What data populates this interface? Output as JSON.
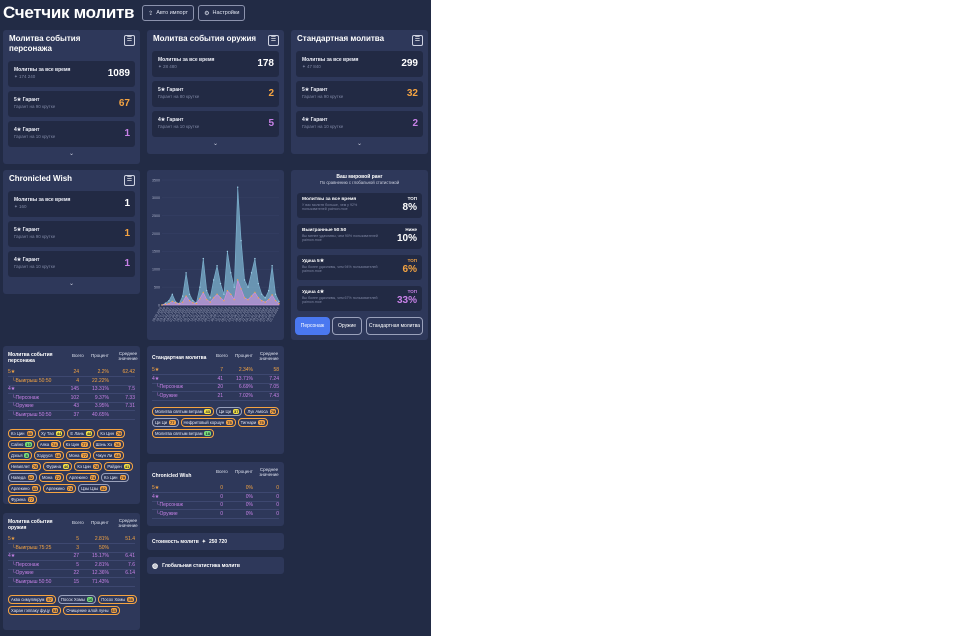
{
  "app": {
    "title": "Счетчик молитв",
    "auto_import": "Авто импорт",
    "settings": "Настройки"
  },
  "panels": {
    "character": {
      "title": "Молитва события персонажа",
      "total_label": "Молитвы за все время",
      "total_sub": "174 240",
      "total": "1089",
      "g5_label": "5★ Гарант",
      "g5_sub": "Гарант на 90 крутке",
      "g5": "67",
      "g4_label": "4★ Гарант",
      "g4_sub": "Гарант на 10 крутке",
      "g4": "1"
    },
    "weapon": {
      "title": "Молитва события оружия",
      "total_label": "Молитвы за все время",
      "total_sub": "28 480",
      "total": "178",
      "g5_label": "5★ Гарант",
      "g5_sub": "Гарант на 80 крутке",
      "g5": "2",
      "g4_label": "4★ Гарант",
      "g4_sub": "Гарант на 10 крутке",
      "g4": "5"
    },
    "standard": {
      "title": "Стандартная молитва",
      "total_label": "Молитвы за все время",
      "total_sub": "47 840",
      "total": "299",
      "g5_label": "5★ Гарант",
      "g5_sub": "Гарант на 90 крутке",
      "g5": "32",
      "g4_label": "4★ Гарант",
      "g4_sub": "Гарант на 10 крутке",
      "g4": "2"
    },
    "chronicled": {
      "title": "Chronicled Wish",
      "total_label": "Молитвы за все время",
      "total_sub": "160",
      "total": "1",
      "g5_label": "5★ Гарант",
      "g5_sub": "Гарант на 90 крутке",
      "g5": "1",
      "g4_label": "4★ Гарант",
      "g4_sub": "Гарант на 10 крутке",
      "g4": "1"
    }
  },
  "chart_data": {
    "type": "area",
    "ylim": [
      0,
      3500
    ],
    "yticks": [
      "0",
      "500",
      "1000",
      "1500",
      "2000",
      "2500",
      "3000",
      "3500"
    ],
    "x": [
      "28.09.2020",
      "10.11.2020",
      "23.12.2020",
      "04.02.2021",
      "19.03.2021",
      "01.05.2021",
      "13.06.2021",
      "26.07.2021",
      "07.09.2021",
      "20.10.2021",
      "02.12.2021",
      "14.01.2022",
      "26.02.2022",
      "10.04.2022",
      "23.05.2022",
      "05.07.2022",
      "17.08.2022",
      "30.09.2022",
      "12.11.2022",
      "25.12.2022",
      "06.02.2023",
      "21.03.2023",
      "03.05.2023",
      "15.06.2023",
      "28.07.2023",
      "09.09.2023",
      "22.10.2023",
      "04.12.2023",
      "16.01.2024",
      "29.02.2024",
      "12.04.2024",
      "25.05.2024",
      "07.07.2024",
      "19.08.2024",
      "01.10.2024"
    ],
    "series": [
      {
        "name": "",
        "values": [
          0,
          50,
          120,
          300,
          80,
          40,
          250,
          900,
          300,
          120,
          60,
          500,
          1300,
          400,
          200,
          700,
          1100,
          600,
          300,
          1500,
          900,
          500,
          3300,
          1800,
          700,
          500,
          900,
          1300,
          600,
          300,
          200,
          400,
          1100,
          300,
          100
        ]
      },
      {
        "name": "",
        "values": [
          0,
          20,
          40,
          100,
          60,
          30,
          80,
          250,
          120,
          60,
          40,
          180,
          350,
          150,
          80,
          200,
          300,
          200,
          120,
          400,
          300,
          150,
          700,
          450,
          200,
          150,
          250,
          350,
          200,
          120,
          80,
          150,
          280,
          120,
          40
        ]
      }
    ]
  },
  "rank": {
    "title": "Ваш мировой ранг",
    "subtitle": "По сравнению с глобальной статистикой",
    "items": [
      {
        "label": "Молитвы за все время",
        "sub": "У вас молитв больше, чем у 92% пользователей paimon.moe",
        "tag": "ТОП",
        "value": "8%",
        "color": "#ffffff"
      },
      {
        "label": "Выигранные 50:50",
        "sub": "Вы менее удачливы, чем 90% пользователей paimon.moe",
        "tag": "Ниже",
        "value": "10%",
        "color": "#ffffff"
      },
      {
        "label": "Удача 5★",
        "sub": "Вы более удачливы, чем 94% пользователей paimon.moe",
        "tag": "ТОП",
        "value": "6%",
        "color": "#f5a442"
      },
      {
        "label": "Удача 4★",
        "sub": "Вы более удачливы, чем 67% пользователей paimon.moe",
        "tag": "ТОП",
        "value": "33%",
        "color": "#c882e8"
      }
    ],
    "tabs": [
      "Персонаж",
      "Оружие",
      "Стандартная молитва"
    ]
  },
  "tables": {
    "headers": [
      "Всего",
      "Процент",
      "Среднее значение"
    ],
    "character": {
      "title": "Молитва события персонажа",
      "rows": [
        {
          "name": "5★",
          "total": "24",
          "pct": "2.2%",
          "avg": "62.42",
          "cls": "c5"
        },
        {
          "name": "└Выигрыш 50:50",
          "total": "4",
          "pct": "22.22%",
          "avg": "",
          "cls": "c5"
        },
        {
          "name": "4★",
          "total": "145",
          "pct": "13.31%",
          "avg": "7.5",
          "cls": "c4"
        },
        {
          "name": "└Персонаж",
          "total": "102",
          "pct": "9.37%",
          "avg": "7.33",
          "cls": "c4"
        },
        {
          "name": "└Оружие",
          "total": "43",
          "pct": "3.95%",
          "avg": "7.31",
          "cls": "c4"
        },
        {
          "name": "└Выигрыш 50:50",
          "total": "37",
          "pct": "40.65%",
          "avg": "",
          "cls": "c4"
        }
      ],
      "pills": [
        {
          "n": "Кэ Цин",
          "v": "80",
          "g": 1,
          "c": "#f5a442"
        },
        {
          "n": "Ху Тао",
          "v": "44",
          "g": 1,
          "c": "#f5e342"
        },
        {
          "n": "Е Лань",
          "v": "48",
          "g": 1,
          "c": "#f5e342"
        },
        {
          "n": "Кэ Цин",
          "v": "79",
          "g": 1,
          "c": "#f5a442"
        },
        {
          "n": "Сайно",
          "v": "10",
          "g": 1,
          "c": "#78e07a"
        },
        {
          "n": "Аяка",
          "v": "74",
          "g": 1,
          "c": "#f5a442"
        },
        {
          "n": "Кэ Цин",
          "v": "77",
          "g": 1,
          "c": "#f5a442"
        },
        {
          "n": "Шэнь Хэ",
          "v": "76",
          "g": 1,
          "c": "#f5a442"
        },
        {
          "n": "Дэхья",
          "v": "8",
          "g": 1,
          "c": "#78e07a"
        },
        {
          "n": "Хэдууся",
          "v": "68",
          "g": 1,
          "c": "#f5a442"
        },
        {
          "n": "Мона",
          "v": "77",
          "g": 1,
          "c": "#f5a442"
        },
        {
          "n": "Чжун Ли",
          "v": "68",
          "g": 1,
          "c": "#f5a442"
        },
        {
          "n": "Невиллет",
          "v": "76",
          "g": 1,
          "c": "#f5a442"
        },
        {
          "n": "Фурина",
          "v": "46",
          "g": 1,
          "c": "#f5e342"
        },
        {
          "n": "Кэ Цин",
          "v": "78",
          "g": 1,
          "c": "#f5a442"
        },
        {
          "n": "Райден",
          "v": "41",
          "g": 1,
          "c": "#f5e342"
        },
        {
          "n": "Наведа",
          "v": "82",
          "g": 0,
          "c": "#f5a442"
        },
        {
          "n": "Мона",
          "v": "72",
          "g": 1,
          "c": "#f5a442"
        },
        {
          "n": "Арлекино",
          "v": "74",
          "g": 1,
          "c": "#f5a442"
        },
        {
          "n": "Кэ Цин",
          "v": "79",
          "g": 0,
          "c": "#f5a442"
        },
        {
          "n": "Арлекино",
          "v": "83",
          "g": 1,
          "c": "#f5a442"
        },
        {
          "n": "Арлекино",
          "v": "74",
          "g": 1,
          "c": "#f5a442"
        },
        {
          "n": "Цзы Цзы",
          "v": "82",
          "g": 0,
          "c": "#f5a442"
        },
        {
          "n": "Фурина",
          "v": "77",
          "g": 1,
          "c": "#f5a442"
        }
      ]
    },
    "standard": {
      "title": "Стандартная молитва",
      "rows": [
        {
          "name": "5★",
          "total": "7",
          "pct": "2.34%",
          "avg": "58",
          "cls": "c5"
        },
        {
          "name": "4★",
          "total": "41",
          "pct": "13.71%",
          "avg": "7.24",
          "cls": "c4"
        },
        {
          "name": "└Персонаж",
          "total": "20",
          "pct": "6.69%",
          "avg": "7.05",
          "cls": "c4"
        },
        {
          "name": "└Оружие",
          "total": "21",
          "pct": "7.02%",
          "avg": "7.43",
          "cls": "c4"
        }
      ],
      "pills": [
        {
          "n": "Молитва святым ветрам",
          "v": "43",
          "g": 1,
          "c": "#f5e342"
        },
        {
          "n": "Ци Ци",
          "v": "37",
          "g": 0,
          "c": "#f5e342"
        },
        {
          "n": "Лук Амоса",
          "v": "79",
          "g": 1,
          "c": "#f5a442"
        },
        {
          "n": "Ци Ци",
          "v": "77",
          "g": 0,
          "c": "#f5a442"
        },
        {
          "n": "Нефритовый коршун",
          "v": "75",
          "g": 1,
          "c": "#f5a442"
        },
        {
          "n": "Тигнари",
          "v": "75",
          "g": 1,
          "c": "#f5a442"
        },
        {
          "n": "Молитва святым ветрам",
          "v": "18",
          "g": 1,
          "c": "#78e07a"
        }
      ]
    },
    "chronicled": {
      "title": "Chronicled Wish",
      "rows": [
        {
          "name": "5★",
          "total": "0",
          "pct": "0%",
          "avg": "0",
          "cls": "c5"
        },
        {
          "name": "4★",
          "total": "0",
          "pct": "0%",
          "avg": "0",
          "cls": "c4"
        },
        {
          "name": "└Персонаж",
          "total": "0",
          "pct": "0%",
          "avg": "0",
          "cls": "c4"
        },
        {
          "name": "└Оружие",
          "total": "0",
          "pct": "0%",
          "avg": "0",
          "cls": "c4"
        }
      ]
    },
    "weapon": {
      "title": "Молитва события оружия",
      "rows": [
        {
          "name": "5★",
          "total": "5",
          "pct": "2.81%",
          "avg": "51.4",
          "cls": "c5"
        },
        {
          "name": "└Выигрыш 75:25",
          "total": "3",
          "pct": "50%",
          "avg": "",
          "cls": "c5"
        },
        {
          "name": "4★",
          "total": "27",
          "pct": "15.17%",
          "avg": "6.41",
          "cls": "c4"
        },
        {
          "name": "└Персонаж",
          "total": "5",
          "pct": "2.81%",
          "avg": "7.6",
          "cls": "c4"
        },
        {
          "name": "└Оружие",
          "total": "22",
          "pct": "12.36%",
          "avg": "6.14",
          "cls": "c4"
        },
        {
          "name": "└Выигрыш 50:50",
          "total": "15",
          "pct": "71.43%",
          "avg": "",
          "cls": "c4"
        }
      ],
      "pills": [
        {
          "n": "Аква симулякрум",
          "v": "57",
          "g": 1,
          "c": "#f5a442"
        },
        {
          "n": "Посох Хомы",
          "v": "16",
          "g": 0,
          "c": "#78e07a"
        },
        {
          "n": "Посох Хомы",
          "v": "58",
          "g": 1,
          "c": "#f5a442"
        },
        {
          "n": "Харан гэппаку фуцу",
          "v": "53",
          "g": 1,
          "c": "#f5a442"
        },
        {
          "n": "Очищение алой луны",
          "v": "63",
          "g": 1,
          "c": "#f5a442"
        }
      ]
    }
  },
  "footer": {
    "cost_label": "Стоимость молитв",
    "cost": "250 720",
    "global": "Глобальная статистика молитв"
  }
}
